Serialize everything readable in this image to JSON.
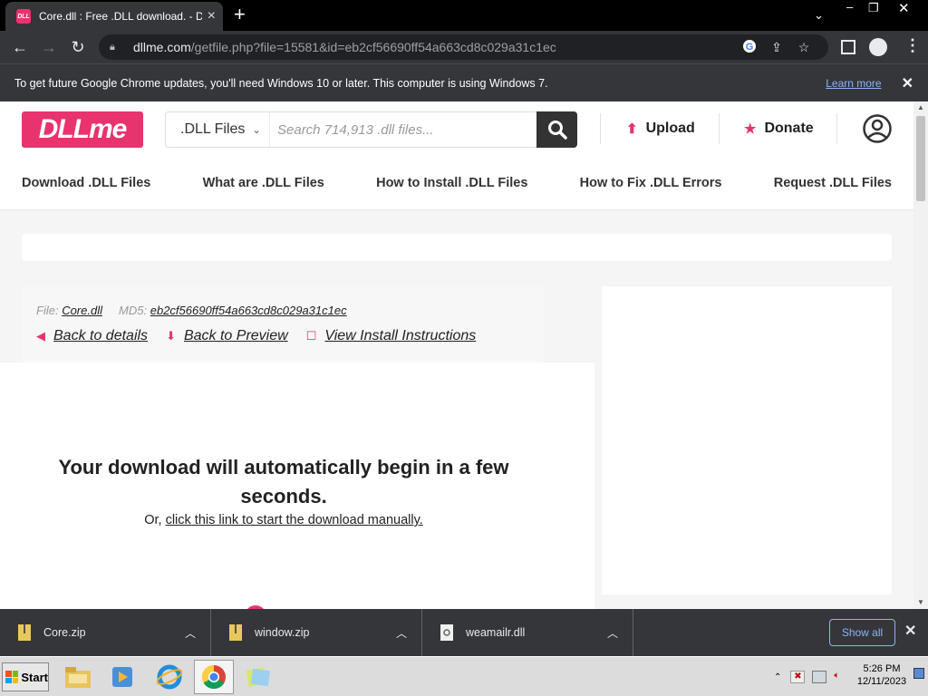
{
  "browser": {
    "tab_title": "Core.dll : Free .DLL download. - DLL",
    "favicon_text": "DLL",
    "url_domain": "dllme.com",
    "url_path": "/getfile.php?file=15581&id=eb2cf56690ff54a663cd8c029a31c1ec",
    "infobar_message": "To get future Google Chrome updates, you'll need Windows 10 or later. This computer is using Windows 7.",
    "infobar_link": "Learn more"
  },
  "site": {
    "logo": "DLLme",
    "search_select": ".DLL Files",
    "search_placeholder": "Search 714,913 .dll files...",
    "upload_label": "Upload",
    "donate_label": "Donate",
    "nav": [
      "Download .DLL Files",
      "What are .DLL Files",
      "How to Install .DLL Files",
      "How to Fix .DLL Errors",
      "Request .DLL Files"
    ],
    "accent_color": "#e8336f"
  },
  "file": {
    "file_label": "File:",
    "file_name": "Core.dll",
    "md5_label": "MD5:",
    "md5": "eb2cf56690ff54a663cd8c029a31c1ec",
    "back_details": "Back to details",
    "back_preview": "Back to Preview",
    "install_instructions": "View Install Instructions"
  },
  "download": {
    "message": "Your download will automatically begin in a few seconds.",
    "manual_prefix": "Or,",
    "manual_link": "click this link to start the download manually."
  },
  "shelf": {
    "items": [
      {
        "name": "Core.zip"
      },
      {
        "name": "window.zip"
      },
      {
        "name": "weamailr.dll"
      }
    ],
    "show_all": "Show all"
  },
  "taskbar": {
    "start": "Start",
    "time": "5:26 PM",
    "date": "12/11/2023"
  }
}
